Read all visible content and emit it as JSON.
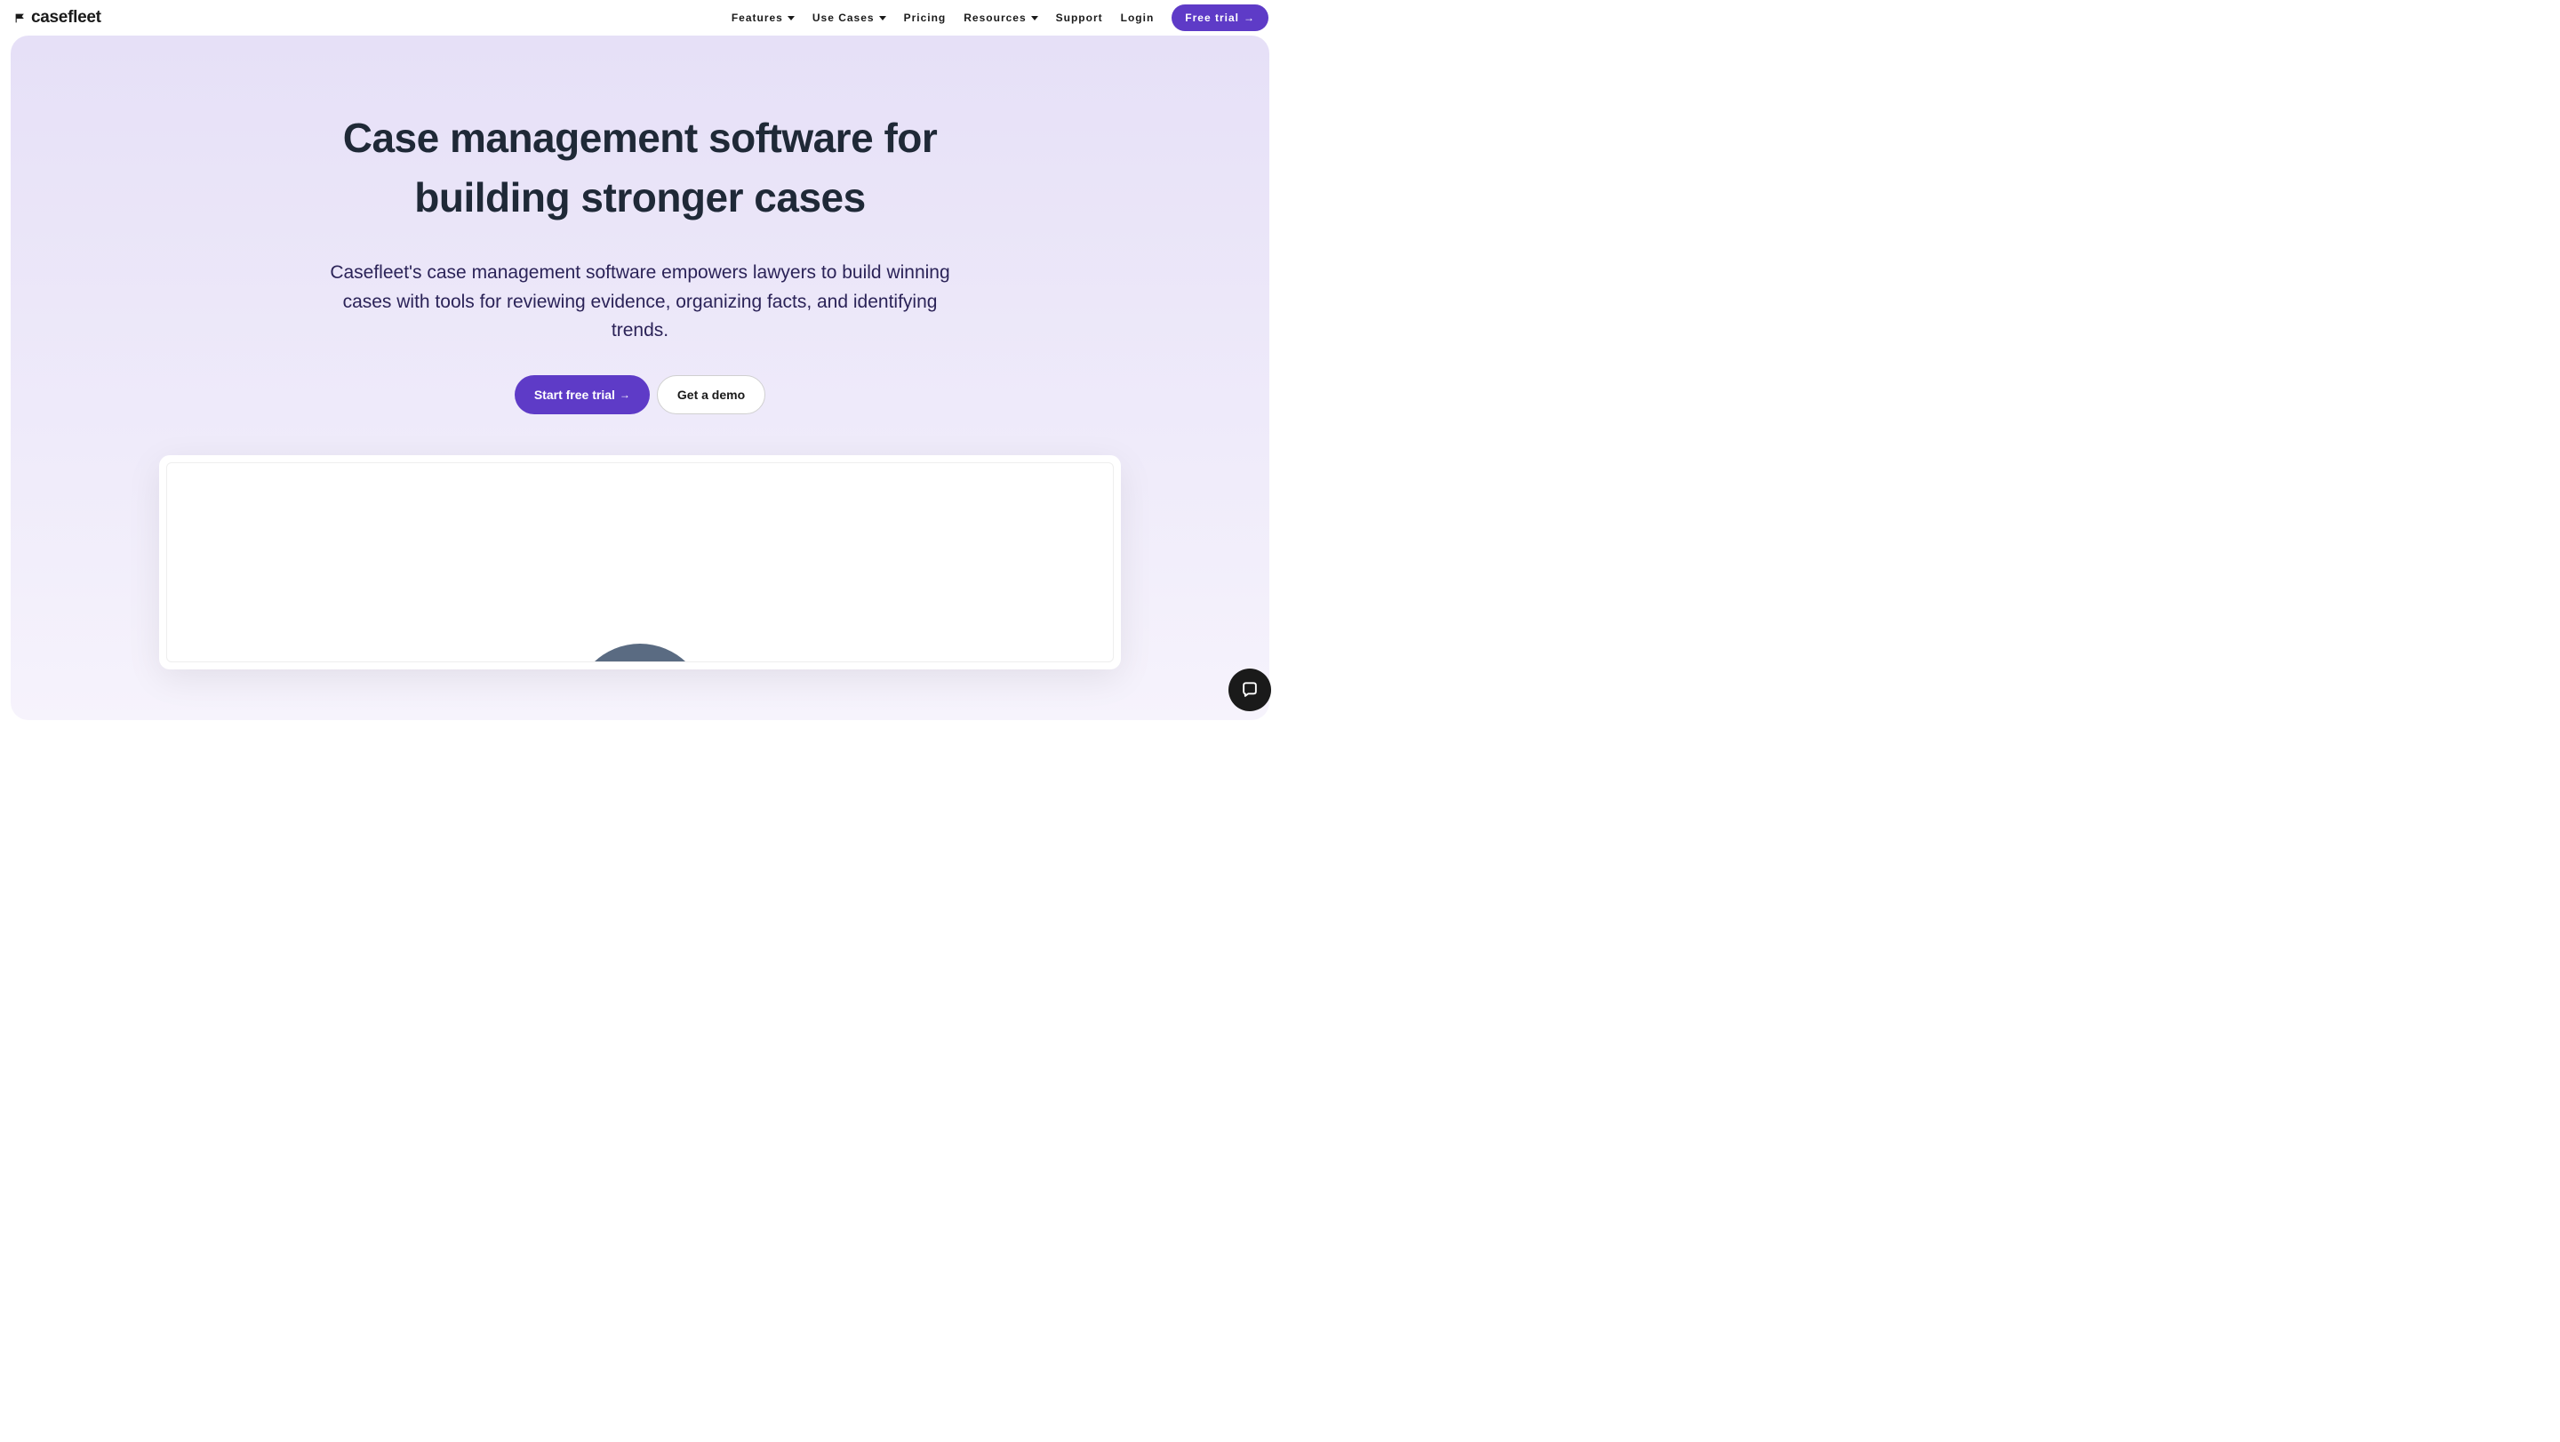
{
  "brand": {
    "name": "casefleet"
  },
  "nav": {
    "items": [
      {
        "label": "Features",
        "hasDropdown": true
      },
      {
        "label": "Use Cases",
        "hasDropdown": true
      },
      {
        "label": "Pricing",
        "hasDropdown": false
      },
      {
        "label": "Resources",
        "hasDropdown": true
      },
      {
        "label": "Support",
        "hasDropdown": false
      },
      {
        "label": "Login",
        "hasDropdown": false
      }
    ],
    "trialButton": "Free trial"
  },
  "hero": {
    "title": "Case management software for building stronger cases",
    "subtitle": "Casefleet's case management software empowers lawyers to build winning cases with tools for reviewing evidence, organizing facts, and identifying trends.",
    "primaryCta": "Start free trial",
    "secondaryCta": "Get a demo"
  },
  "colors": {
    "primary": "#5e3bc7",
    "heroBg": "#E6E0F7",
    "text": "#1a1a1a",
    "subtitleText": "#2b2358"
  }
}
